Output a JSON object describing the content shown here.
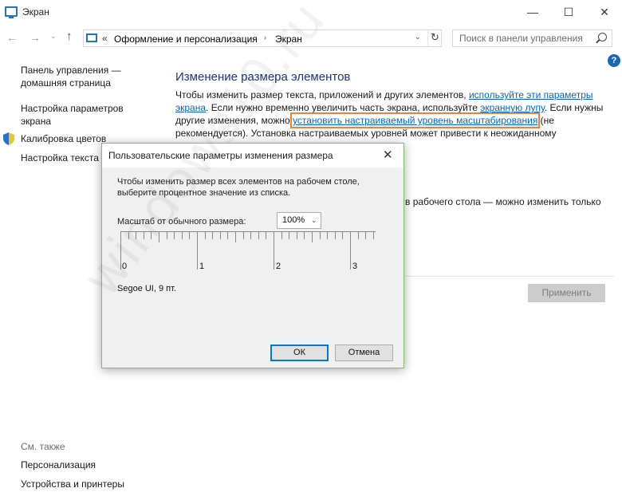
{
  "window": {
    "title": "Экран",
    "controls": {
      "minimize": "—",
      "maximize": "☐",
      "close": "✕"
    }
  },
  "nav": {
    "back": "←",
    "forward": "→",
    "recent": "⌄",
    "up": "↑",
    "breadcrumb_prefix": "«",
    "breadcrumbs": [
      "Оформление и персонализация",
      "Экран"
    ],
    "crumb_separator": "›",
    "dropdown": "⌄",
    "refresh": "↻",
    "search_placeholder": "Поиск в панели управления"
  },
  "help": "?",
  "sidebar": {
    "items": [
      {
        "label": "Панель управления — домашняя страница"
      },
      {
        "label": "Настройка параметров экрана"
      },
      {
        "label": "Калибровка цветов",
        "icon": "shield-icon"
      },
      {
        "label": "Настройка текста ClearType"
      }
    ],
    "see_also": {
      "heading": "См. также",
      "items": [
        "Персонализация",
        "Устройства и принтеры"
      ]
    }
  },
  "main": {
    "title": "Изменение размера элементов",
    "para": {
      "t1": "Чтобы изменить размер текста, приложений и других элементов, ",
      "link1": "используйте эти параметры экрана",
      "t2": ". Если нужно временно увеличить часть экрана, используйте ",
      "link2": "экранную лупу",
      "t3": ". Если нужны другие изменения, можно ",
      "link3": "установить настраиваемый уровень масштабирования",
      "t4": " (не рекомендуется). Установка настраиваемых уровней может привести к неожиданному поведению на некоторых экранах."
    },
    "line2": "в рабочего стола — можно изменить только",
    "apply_button": "Применить"
  },
  "dialog": {
    "title": "Пользовательские параметры изменения размера",
    "close": "✕",
    "description": "Чтобы изменить размер всех элементов на рабочем столе, выберите процентное значение из списка.",
    "scale_label": "Масштаб от обычного размера:",
    "scale_value": "100%",
    "ruler_numbers": [
      "0",
      "1",
      "2",
      "3"
    ],
    "font_sample": "Segoe UI, 9 пт.",
    "ok": "ОК",
    "cancel": "Отмена"
  },
  "colors": {
    "accent": "#0078d7",
    "title_blue": "#1e3287",
    "link": "#0066cc",
    "highlight": "#e8813a",
    "dialog_border": "#7fbf5f"
  }
}
